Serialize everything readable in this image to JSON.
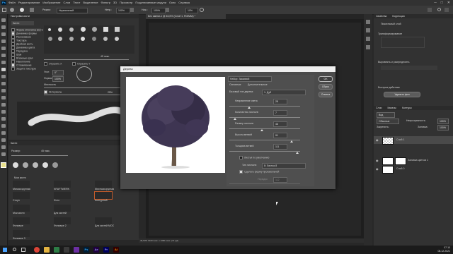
{
  "menubar": {
    "logo": "Ps",
    "items": [
      "Файл",
      "Редактирование",
      "Изображение",
      "Слои",
      "Текст",
      "Выделение",
      "Фильтр",
      "3D",
      "Просмотр",
      "Подключаемые модули",
      "Окно",
      "Справка"
    ],
    "window_controls": [
      "─",
      "□",
      "✕"
    ]
  },
  "options": {
    "mode": "Нормальный",
    "opacity_label": "Непр.:",
    "opacity": "100%",
    "flow_label": "Наж.:",
    "flow": "100%",
    "smoothing": "10%"
  },
  "brush_settings": {
    "header": "Настройки кисти",
    "tab": "Кисти",
    "items": [
      {
        "label": "Форма отпечатка кисти",
        "checked": false
      },
      {
        "label": "Динамика формы",
        "checked": true
      },
      {
        "label": "Рассеивание",
        "checked": false
      },
      {
        "label": "Текстура",
        "checked": false
      },
      {
        "label": "Двойная кисть",
        "checked": false
      },
      {
        "label": "Динамика цвета",
        "checked": false
      },
      {
        "label": "Передача",
        "checked": false
      },
      {
        "label": "Шум",
        "checked": false
      },
      {
        "label": "Влажные края",
        "checked": false
      },
      {
        "label": "Накопление",
        "checked": false
      },
      {
        "label": "Сглаживание",
        "checked": true
      },
      {
        "label": "Защита текстуры",
        "checked": false
      }
    ],
    "size_value": "45 пикс.",
    "flip_x": "Отразить X",
    "flip_y": "Отразить Y",
    "angle_label": "Угол:",
    "angle": "0°",
    "roundness_label": "Форма:",
    "roundness": "100%",
    "hardness_label": "Жесткость",
    "spacing_label": "Интервалы",
    "spacing": "25%"
  },
  "brushes_panel": {
    "header": "Кисти",
    "size_label": "Размер:",
    "size": "45 пикс.",
    "group_label": "Мои кисти",
    "brushes": [
      "Мягкая круглая",
      "KRAFTWERK",
      "Жесткая круглая",
      "Стоун",
      "Фото",
      "Контурный",
      "Мои кисти",
      "Для кистей",
      "Фоновые",
      "Фоновые 2",
      "Для кистей МОС",
      "Фоновые 3"
    ]
  },
  "document": {
    "tab_title": "Без имени-1 @ 46,5% (Слой 1, RGB/8#) *",
    "status": "46,53%    1920 пикс. x 1080 пикс. (72 ppi)"
  },
  "dialog": {
    "title": "Дерево",
    "preset_label": "Набор: Заказной",
    "tabs": [
      "Основные",
      "Дополнительные"
    ],
    "base_type_label": "Базовый тип дерева:",
    "base_type": "1: Дуб",
    "params": [
      {
        "label": "Направление света",
        "value": "28"
      },
      {
        "label": "Количество листьев",
        "value": "7"
      },
      {
        "label": "Размер листьев",
        "value": "46"
      },
      {
        "label": "Высота ветвей",
        "value": "91"
      },
      {
        "label": "Толщина ветвей",
        "value": "111"
      }
    ],
    "default_leaves_label": "Листья по умолчанию",
    "default_leaves_checked": false,
    "leaf_type_label": "Тип листьев:",
    "leaf_type": "8: Листья 8",
    "arbitrary_shape_label": "Сделать форму произвольной",
    "arbitrary_shape_checked": true,
    "arrangement_label": "Порядок",
    "arrangement_value": "112",
    "ok": "OK",
    "reset": "Сброс",
    "cancel": "Отмена"
  },
  "properties": {
    "header": "Свойства",
    "tab2": "Коррекция",
    "pixel_layer": "Пиксельный слой",
    "transform_label": "Трансформирование",
    "align_label": "Выровнять и распределить",
    "quick_actions": "Быстрые действия",
    "remove_bg": "Удалить фон"
  },
  "layers": {
    "header": "Слои",
    "tabs": [
      "Слои",
      "Каналы",
      "Контуры"
    ],
    "search": "Вид",
    "blend_mode": "Обычные",
    "opacity_label": "Непрозрачность:",
    "opacity": "100%",
    "lock_label": "Закрепить:",
    "fill_label": "Заливка:",
    "fill": "100%",
    "rows": [
      {
        "name": "Слой 1",
        "type": "checker"
      },
      {
        "name": "Заливка цветом 1",
        "type": "white"
      },
      {
        "name": "Слой 0",
        "type": "white"
      }
    ]
  },
  "taskbar": {
    "time": "07:10",
    "date": "08.12.2021",
    "apps": [
      {
        "label": "Ps",
        "color": "#001e36"
      },
      {
        "label": "Ae",
        "color": "#1f0140"
      },
      {
        "label": "Pr",
        "color": "#00005b"
      },
      {
        "label": "Ai",
        "color": "#330000"
      }
    ]
  }
}
